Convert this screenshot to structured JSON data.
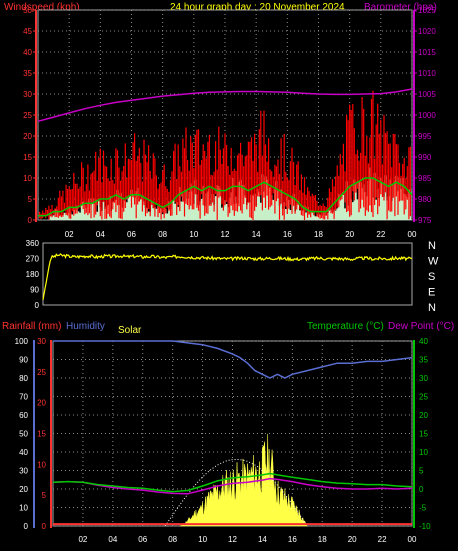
{
  "header": {
    "title": "24 hour graph day : 20 November 2024",
    "windspeed_label": "Windspeed (kph)",
    "barometer_label": "Barometer (hpa)",
    "rainfall_label": "Rainfall (mm)",
    "humidity_label": "Humidity",
    "solar_label": "Solar",
    "temperature_label": "Temperature (°C)",
    "dewpoint_label": "Dew Point (°C)"
  },
  "colors": {
    "wind_gust": "#ff0000",
    "wind_avg": "#00c800",
    "wind_bars": "#c8f0c8",
    "barometer": "#c800c8",
    "direction": "#ffff00",
    "humidity": "#5a6ed2",
    "temperature": "#00c800",
    "dewpoint": "#c800c8",
    "solar": "#ffff46",
    "rain": "#ff3232",
    "grid": "#8c8c8c"
  },
  "chart_data": [
    {
      "type": "line",
      "name": "wind-and-pressure",
      "x_ticks": [
        "02",
        "04",
        "06",
        "08",
        "10",
        "12",
        "14",
        "16",
        "18",
        "20",
        "22",
        "00"
      ],
      "xlim": [
        0,
        24
      ],
      "ylim_left": [
        0,
        50
      ],
      "ylim_right": [
        975,
        1025
      ],
      "left_ticks": [
        "0",
        "5",
        "10",
        "15",
        "20",
        "25",
        "30",
        "35",
        "40",
        "45",
        "50"
      ],
      "right_ticks": [
        "975",
        "980",
        "985",
        "990",
        "995",
        "1000",
        "1005",
        "1010",
        "1015",
        "1020",
        "1025"
      ],
      "grid": true,
      "series": [
        {
          "name": "Windspeed (kph)",
          "axis": "left",
          "x": [
            0,
            0.5,
            1,
            1.5,
            2,
            2.5,
            3,
            3.5,
            4,
            4.5,
            5,
            5.5,
            6,
            6.5,
            7,
            7.5,
            8,
            8.5,
            9,
            9.5,
            10,
            10.5,
            11,
            11.5,
            12,
            12.5,
            13,
            13.5,
            14,
            14.5,
            15,
            15.5,
            16,
            16.5,
            17,
            17.5,
            18,
            18.5,
            19,
            19.5,
            20,
            20.5,
            21,
            21.5,
            22,
            22.5,
            23,
            23.5,
            24
          ],
          "gust": [
            2,
            3,
            4,
            6,
            8,
            10,
            12,
            13,
            15,
            14,
            16,
            15,
            17,
            16,
            15,
            13,
            11,
            12,
            17,
            18,
            19,
            18,
            20,
            18,
            17,
            19,
            18,
            17,
            20,
            22,
            19,
            17,
            16,
            13,
            9,
            6,
            5,
            5,
            9,
            16,
            23,
            26,
            24,
            25,
            22,
            19,
            20,
            15,
            14
          ],
          "avg": [
            1,
            1,
            2,
            2,
            3,
            3,
            4,
            4,
            5,
            5,
            6,
            5,
            6,
            6,
            5,
            4,
            3,
            4,
            6,
            7,
            8,
            7,
            8,
            7,
            7,
            8,
            8,
            7,
            8,
            9,
            8,
            7,
            6,
            5,
            3,
            2,
            2,
            2,
            4,
            6,
            8,
            9,
            10,
            10,
            9,
            8,
            9,
            8,
            6
          ]
        },
        {
          "name": "Barometer (hpa)",
          "axis": "right",
          "x": [
            0,
            1,
            2,
            3,
            4,
            5,
            6,
            7,
            8,
            9,
            10,
            11,
            12,
            13,
            14,
            15,
            16,
            17,
            18,
            19,
            20,
            21,
            22,
            23,
            24
          ],
          "values": [
            998.5,
            999.5,
            1000.5,
            1001.5,
            1002.3,
            1003,
            1003.5,
            1004,
            1004.5,
            1004.8,
            1005.2,
            1005.4,
            1005.5,
            1005.6,
            1005.6,
            1005.5,
            1005.4,
            1005.2,
            1005,
            1004.9,
            1004.9,
            1005,
            1005.1,
            1005.5,
            1006.2
          ]
        }
      ]
    },
    {
      "type": "line",
      "name": "wind-direction",
      "x_ticks": [],
      "xlim": [
        0,
        24
      ],
      "ylim_left": [
        0,
        360
      ],
      "left_ticks": [
        "0",
        "90",
        "180",
        "270",
        "360"
      ],
      "right_labels": [
        "N",
        "W",
        "S",
        "E",
        "N"
      ],
      "series": [
        {
          "name": "Wind direction",
          "x": [
            0,
            0.5,
            1,
            1.5,
            2,
            2.5,
            3,
            3.5,
            4,
            4.5,
            5,
            5.5,
            6,
            6.5,
            7,
            7.5,
            8,
            8.5,
            9,
            9.5,
            10,
            10.5,
            11,
            11.5,
            12,
            12.5,
            13,
            13.5,
            14,
            14.5,
            15,
            15.5,
            16,
            16.5,
            17,
            17.5,
            18,
            18.5,
            19,
            19.5,
            20,
            20.5,
            21,
            21.5,
            22,
            22.5,
            23,
            23.5,
            24
          ],
          "values": [
            30,
            275,
            290,
            285,
            280,
            282,
            285,
            278,
            284,
            281,
            286,
            280,
            283,
            279,
            282,
            278,
            276,
            280,
            282,
            278,
            276,
            274,
            272,
            270,
            268,
            270,
            272,
            270,
            268,
            270,
            272,
            270,
            268,
            266,
            268,
            270,
            272,
            268,
            270,
            268,
            266,
            270,
            272,
            268,
            270,
            268,
            272,
            270,
            268
          ]
        }
      ]
    },
    {
      "type": "line",
      "name": "rain-humidity-temperature",
      "x_ticks": [
        "02",
        "04",
        "06",
        "08",
        "10",
        "12",
        "14",
        "16",
        "18",
        "20",
        "22",
        "00"
      ],
      "xlim": [
        0,
        24
      ],
      "rain_ticks": [
        "0",
        "5",
        "10",
        "15",
        "20",
        "25",
        "30"
      ],
      "humidity_ticks": [
        "0",
        "10",
        "20",
        "30",
        "40",
        "50",
        "60",
        "70",
        "80",
        "90",
        "100"
      ],
      "temp_ticks": [
        "-10",
        "-5",
        "0",
        "5",
        "10",
        "15",
        "20",
        "25",
        "30",
        "35",
        "40"
      ],
      "ylim_rain": [
        0,
        30
      ],
      "ylim_humidity": [
        0,
        100
      ],
      "ylim_temp": [
        -10,
        40
      ],
      "grid": true,
      "series": [
        {
          "name": "Humidity",
          "x": [
            0,
            1,
            2,
            3,
            4,
            5,
            6,
            7,
            8,
            9,
            10,
            11,
            12,
            12.5,
            13,
            13.5,
            14,
            14.5,
            15,
            15.5,
            16,
            17,
            18,
            19,
            20,
            21,
            22,
            23,
            24
          ],
          "values": [
            100,
            100,
            100,
            100,
            100,
            100,
            100,
            100,
            100,
            99,
            98,
            96,
            93,
            91,
            88,
            84,
            82,
            80,
            82,
            80,
            82,
            84,
            86,
            88,
            88,
            89,
            89,
            90,
            91
          ]
        },
        {
          "name": "Temperature (°C)",
          "x": [
            0,
            1,
            2,
            3,
            4,
            5,
            6,
            7,
            8,
            9,
            10,
            11,
            12,
            13,
            14,
            14.5,
            15,
            16,
            17,
            18,
            19,
            20,
            21,
            22,
            23,
            24
          ],
          "values": [
            1.8,
            2,
            1.8,
            1.2,
            0.8,
            0.4,
            0.2,
            -0.3,
            -0.7,
            -0.4,
            0.8,
            2.2,
            3,
            3.3,
            3.8,
            4.2,
            3.8,
            3.2,
            2.6,
            2,
            1.6,
            1.4,
            1.2,
            1.2,
            0.8,
            0.6
          ]
        },
        {
          "name": "Dew Point (°C)",
          "x": [
            0,
            1,
            2,
            3,
            4,
            5,
            6,
            7,
            8,
            9,
            10,
            11,
            12,
            13,
            14,
            14.5,
            15,
            16,
            17,
            18,
            19,
            20,
            21,
            22,
            23,
            24
          ],
          "values": [
            1.8,
            2,
            1.8,
            1,
            0.4,
            0,
            -0.3,
            -0.8,
            -1.2,
            -1.3,
            -0.3,
            0.8,
            1.5,
            1.8,
            2.4,
            2.8,
            2.6,
            2,
            1.2,
            0.6,
            0.2,
            0,
            0,
            0.2,
            0,
            0.2
          ]
        },
        {
          "name": "Solar",
          "x": [
            8.5,
            9,
            9.5,
            10,
            10.5,
            11,
            11.5,
            12,
            12.5,
            13,
            13.5,
            14,
            14.2,
            14.5,
            14.8,
            15,
            15.5,
            16,
            16.5,
            17
          ],
          "values": [
            0,
            3,
            8,
            12,
            18,
            22,
            26,
            28,
            30,
            31,
            34,
            36,
            44,
            40,
            32,
            22,
            18,
            14,
            8,
            0
          ]
        },
        {
          "name": "Rainfall (mm)",
          "x": [
            0,
            24
          ],
          "values": [
            0.3,
            0.3
          ]
        }
      ]
    }
  ]
}
